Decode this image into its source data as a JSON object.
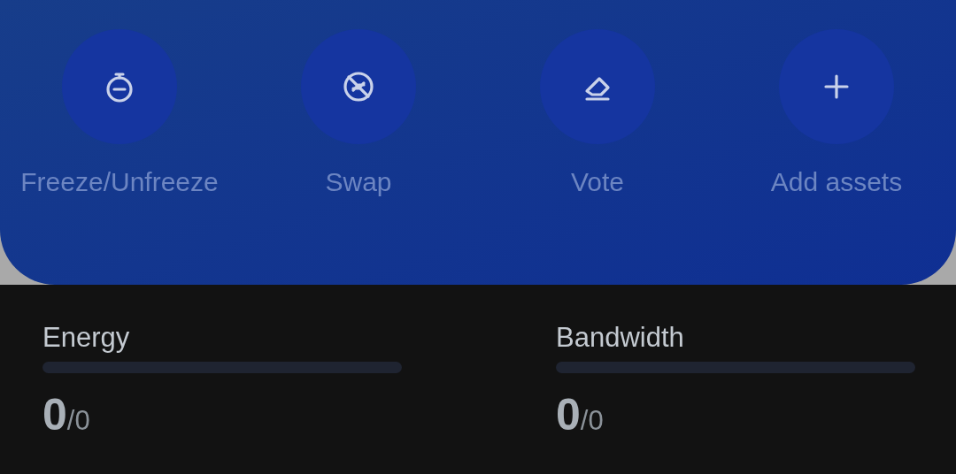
{
  "actions": [
    {
      "kind": "freeze",
      "label": "Freeze/Unfreeze"
    },
    {
      "kind": "swap",
      "label": "Swap"
    },
    {
      "kind": "vote",
      "label": "Vote"
    },
    {
      "kind": "add",
      "label": "Add assets"
    }
  ],
  "resources": [
    {
      "label": "Energy",
      "level": 0,
      "used": "0",
      "total": "/0"
    },
    {
      "label": "Bandwidth",
      "level": 0,
      "used": "0",
      "total": "/0"
    }
  ]
}
